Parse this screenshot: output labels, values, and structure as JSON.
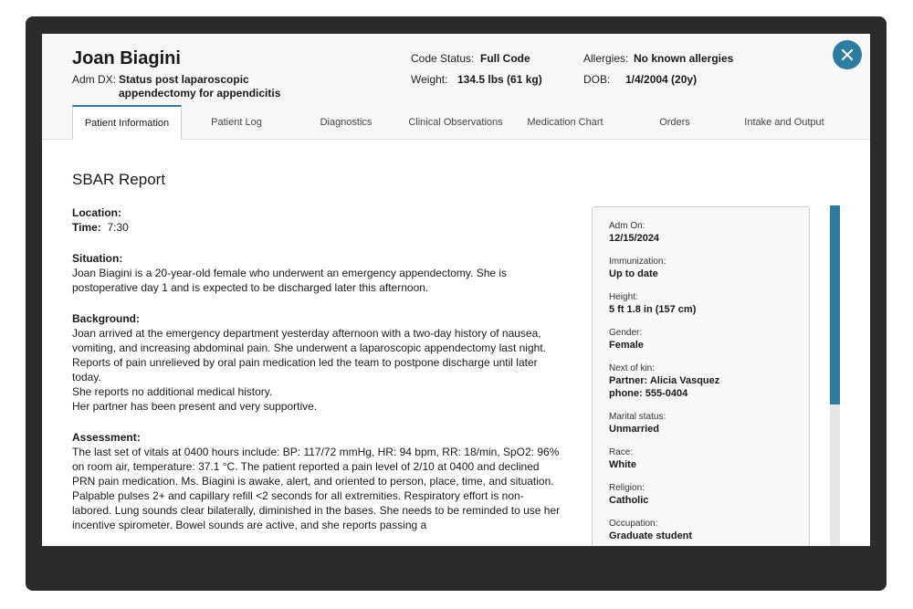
{
  "patient": {
    "name": "Joan Biagini",
    "adm_dx_label": "Adm DX:",
    "adm_dx_value": "Status post laparoscopic appendectomy for appendicitis",
    "code_status_label": "Code Status:",
    "code_status_value": "Full Code",
    "weight_label": "Weight:",
    "weight_value": "134.5 lbs (61 kg)",
    "allergies_label": "Allergies:",
    "allergies_value": "No known allergies",
    "dob_label": "DOB:",
    "dob_value": "1/4/2004 (20y)"
  },
  "tabs": [
    {
      "label": "Patient Information"
    },
    {
      "label": "Patient Log"
    },
    {
      "label": "Diagnostics"
    },
    {
      "label": "Clinical Observations"
    },
    {
      "label": "Medication Chart"
    },
    {
      "label": "Orders"
    },
    {
      "label": "Intake and Output"
    }
  ],
  "active_tab": "Patient Information",
  "report": {
    "title": "SBAR Report",
    "location_label": "Location:",
    "location_value": "",
    "time_label": "Time:",
    "time_value": "7:30",
    "situation_label": "Situation:",
    "situation_text": "Joan Biagini is a 20-year-old female who underwent an emergency appendectomy. She is postoperative day 1 and is expected to be discharged later this afternoon.",
    "background_label": "Background:",
    "background_lines": [
      "Joan arrived at the emergency department yesterday afternoon with a two-day history of nausea, vomiting, and increasing abdominal pain. She underwent a laparoscopic appendectomy last night.",
      "Reports of pain unrelieved by oral pain medication led the team to postpone discharge until later today.",
      "She reports no additional medical history.",
      "Her partner has been present and very supportive."
    ],
    "assessment_label": "Assessment:",
    "assessment_text": "The last set of vitals at 0400 hours include: BP: 117/72 mmHg, HR: 94 bpm, RR: 18/min, SpO2: 96% on room air, temperature: 37.1 °C. The patient reported a pain level of 2/10 at 0400 and declined PRN pain medication. Ms. Biagini is awake, alert, and oriented to person, place, time, and situation. Palpable pulses 2+ and capillary refill <2 seconds for all extremities. Respiratory effort is non-labored. Lung sounds clear bilaterally, diminished in the bases. She needs to be reminded to use her incentive spirometer. Bowel sounds are active, and she reports passing a"
  },
  "sidebar": {
    "items": [
      {
        "label": "Adm On:",
        "value": "12/15/2024"
      },
      {
        "label": "Immunization:",
        "value": "Up to date"
      },
      {
        "label": "Height:",
        "value": "5 ft 1.8 in (157 cm)"
      },
      {
        "label": "Gender:",
        "value": "Female"
      },
      {
        "label": "Next of kin:",
        "value": "Partner: Alicia Vasquez",
        "value2": "phone: 555-0404"
      },
      {
        "label": "Marital status:",
        "value": "Unmarried"
      },
      {
        "label": "Race:",
        "value": "White"
      },
      {
        "label": "Religion:",
        "value": "Catholic"
      },
      {
        "label": "Occupation:",
        "value": "Graduate student"
      }
    ]
  },
  "colors": {
    "accent": "#2e7da0",
    "frame": "#2b2b2b",
    "header_bg": "#f7f7f7"
  },
  "icons": {
    "close": "close-icon"
  }
}
